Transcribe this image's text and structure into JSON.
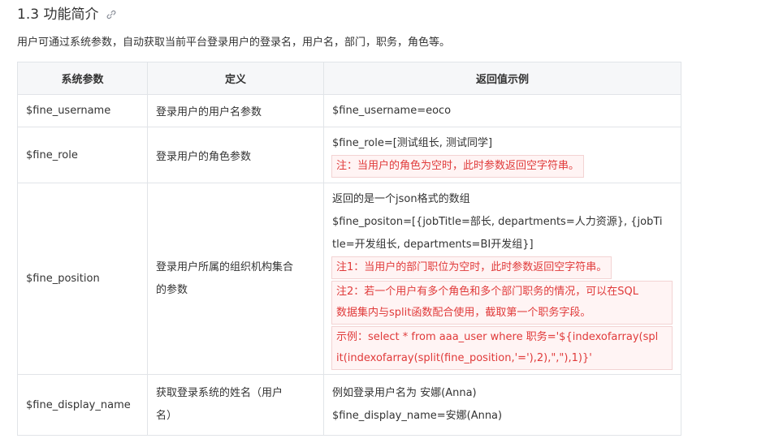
{
  "section": {
    "title": "1.3 功能简介",
    "link_icon": "link-icon"
  },
  "intro": "用户可通过系统参数，自动获取当前平台登录用户的登录名，用户名，部门，职务，角色等。",
  "table": {
    "headers": [
      "系统参数",
      "定义",
      "返回值示例"
    ],
    "rows": [
      {
        "param": "$fine_username",
        "definition": "登录用户的用户名参数",
        "example": "$fine_username=eoco"
      },
      {
        "param": "$fine_role",
        "definition": "登录用户的角色参数",
        "example": "$fine_role=[测试组长, 测试同学]",
        "note": "注：当用户的角色为空时，此时参数返回空字符串。"
      },
      {
        "param": "$fine_position",
        "definition_line1": "登录用户所属的组织机构集合",
        "definition_line2": "的参数",
        "desc": "返回的是一个json格式的数组",
        "example_line1": "$fine_positon=[{jobTitle=部长, departments=人力资源}, {jobTi",
        "example_line2": "tle=开发组长, departments=BI开发组}]",
        "note1": "注1：当用户的部门职位为空时，此时参数返回空字符串。",
        "note2_line1": "注2：若一个用户有多个角色和多个部门职务的情况，可以在SQL",
        "note2_line2": "数据集内与split函数配合使用，截取第一个职务字段。",
        "note3_line1": "示例：select * from aaa_user where 职务='${indexofarray(spl",
        "note3_line2": "it(indexofarray(split(fine_position,'='),2),\",\"),1)}'"
      },
      {
        "param": "$fine_display_name",
        "definition_line1": "获取登录系统的姓名（用户",
        "definition_line2": "名）",
        "example_line1": "例如登录用户名为 安娜(Anna)",
        "example_line2": "$fine_display_name=安娜(Anna)"
      }
    ]
  },
  "colors": {
    "note_text": "#e03a3a",
    "note_bg": "#fff4f4",
    "header_bg": "#f6f7f9",
    "border": "#e1e4e8"
  }
}
